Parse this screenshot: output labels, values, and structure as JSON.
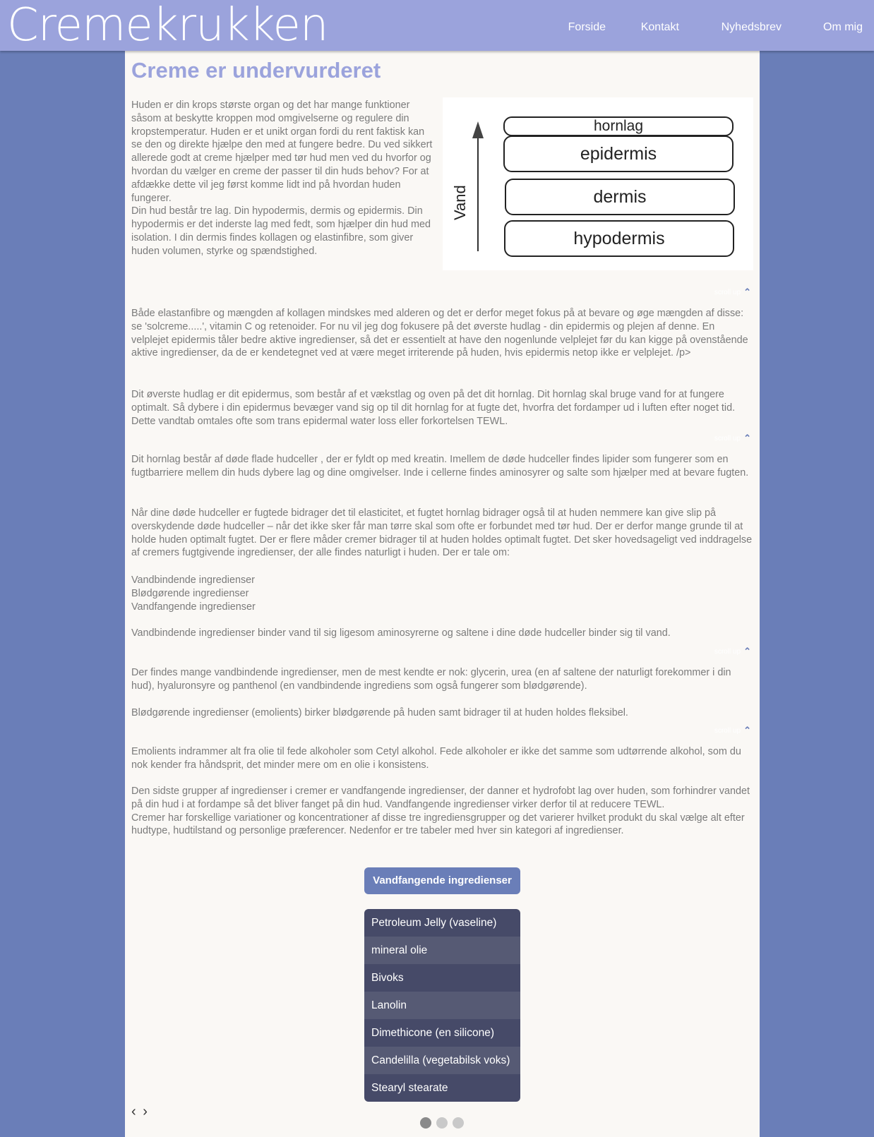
{
  "site": {
    "logo": "Cremekrukken"
  },
  "nav": [
    {
      "label": "Forside"
    },
    {
      "label": "Kontakt"
    },
    {
      "label": "Nyhedsbrev"
    },
    {
      "label": "Om mig"
    }
  ],
  "article": {
    "title": "Creme er undervurderet",
    "intro": "Huden er din krops største organ og det har mange funktioner såsom at beskytte kroppen mod omgivelserne og regulere din kropstemperatur. Huden er et unikt organ fordi du rent faktisk kan se den og direkte hjælpe den med at fungere bedre. Du ved sikkert allerede godt at creme hjælper med tør hud men ved du hvorfor og hvordan du vælger en creme der passer til din huds behov? For at afdække dette vil jeg først komme lidt ind på hvordan huden fungerer.\nDin hud består tre lag. Din hypodermis, dermis og epidermis. Din hypodermis er det inderste lag med fedt, som hjælper din hud med isolation. I din dermis findes kollagen og elastinfibre, som giver huden volumen, styrke og spændstighed.",
    "p1": "Både elastanfibre og mængden af kollagen mindskes med alderen og det er derfor meget fokus på at bevare og øge mængden af disse: se 'solcreme.....', vitamin C og retenoider. For nu vil jeg dog fokusere på det øverste hudlag - din epidermis og plejen af denne. En velplejet epidermis tåler bedre aktive ingredienser, så det er essentielt at have den nogenlunde velplejet før du kan kigge på ovenstående aktive ingredienser, da de er kendetegnet ved at være meget irriterende på huden, hvis epidermis netop ikke er velplejet. /p>",
    "p2": "Dit øverste hudlag er dit epidermus, som består af et vækstlag og oven på det dit hornlag. Dit hornlag skal bruge vand for at fungere optimalt. Så dybere i din epidermus bevæger vand sig op til dit hornlag for at fugte det, hvorfra det fordamper ud i luften efter noget tid. Dette vandtab omtales ofte som trans epidermal water loss eller forkortelsen TEWL.",
    "p3": "Dit hornlag består af døde flade hudceller , der er fyldt op med kreatin. Imellem de døde hudceller findes lipider som fungerer som en fugtbarriere mellem din huds dybere lag og dine omgivelser. Inde i cellerne findes aminosyrer og salte som hjælper med at bevare fugten.",
    "p4": "Når dine døde hudceller er fugtede bidrager det til elasticitet, et fugtet hornlag bidrager også til at huden nemmere kan give slip på overskydende døde hudceller – når det ikke sker får man tørre skal som ofte er forbundet med tør hud. Der er derfor mange grunde til at holde huden optimalt fugtet. Der er flere måder cremer bidrager til at huden holdes optimalt fugtet. Det sker hovedsageligt ved inddragelse af cremers fugtgivende ingredienser, der alle findes naturligt i huden. Der er tale om:",
    "list1": "Vandbindende ingredienser",
    "list2": "Blødgørende ingredienser",
    "list3": "Vandfangende ingredienser",
    "p5": "Vandbindende ingredienser binder vand til sig ligesom aminosyrerne og saltene i dine døde hudceller binder sig til vand.",
    "p6": "Der findes mange vandbindende ingredienser, men de mest kendte er nok: glycerin, urea (en af saltene der naturligt forekommer i din hud), hyaluronsyre og panthenol (en vandbindende ingrediens som også fungerer som blødgørende).",
    "p7": "Blødgørende ingredienser (emolients) birker blødgørende på huden samt bidrager til at huden holdes fleksibel.",
    "p8": "Emolients indrammer alt fra olie til fede alkoholer som Cetyl alkohol. Fede alkoholer er ikke det samme som udtørrende alkohol, som du nok kender fra håndsprit, det minder mere om en olie i konsistens.",
    "p9": "Den sidste grupper af ingredienser i cremer er vandfangende ingredienser, der danner et hydrofobt lag over huden, som forhindrer vandet på din hud i at fordampe så det bliver fanget på din hud. Vandfangende ingredienser virker derfor til at reducere TEWL.\nCremer har forskellige variationer og koncentrationer af disse tre ingrediensgrupper og det varierer hvilket produkt du skal vælge alt efter hudtype, hudtilstand og personlige præferencer. Nedenfor er tre tabeler med hver sin kategori af ingredienser."
  },
  "diagram": {
    "layers": [
      "hornlag",
      "epidermis",
      "dermis",
      "hypodermis"
    ],
    "axis_label": "Vand"
  },
  "scroll_up": "scroll up",
  "carousel": {
    "title": "Vandfangende ingredienser",
    "items": [
      "Petroleum Jelly (vaseline)",
      "mineral olie",
      "Bivoks",
      "Lanolin",
      "Dimethicone (en silicone)",
      "Candelilla (vegetabilsk voks)",
      "Stearyl stearate"
    ],
    "arrows": "‹ ›",
    "active_dot": 1
  }
}
